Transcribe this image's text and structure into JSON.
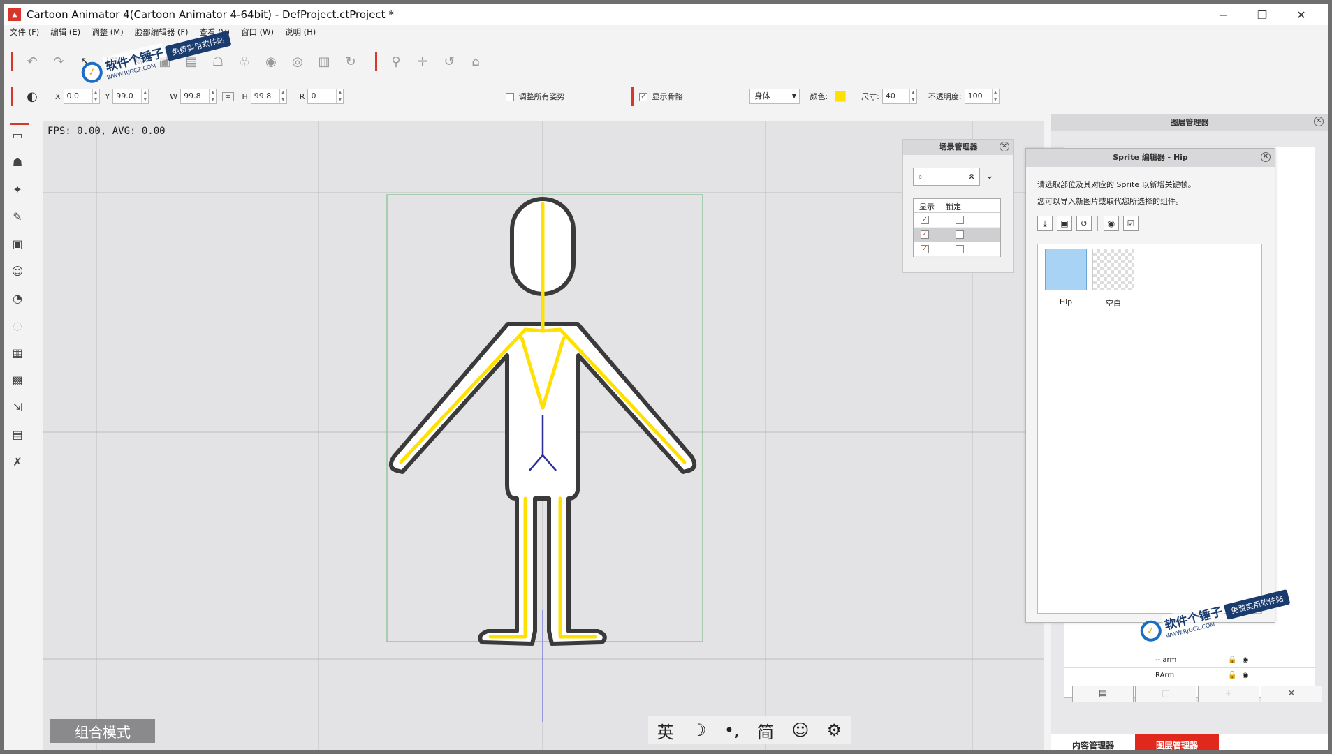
{
  "window": {
    "title": "Cartoon Animator 4(Cartoon Animator 4-64bit) - DefProject.ctProject *",
    "minimize": "−",
    "restore": "❐",
    "close": "✕"
  },
  "menu": [
    "文件 (F)",
    "编辑 (E)",
    "调整 (M)",
    "脸部编辑器 (F)",
    "查看 (V)",
    "窗口 (W)",
    "说明 (H)"
  ],
  "transform": {
    "x_label": "X",
    "x_value": "0.0",
    "y_label": "Y",
    "y_value": "99.0",
    "w_label": "W",
    "w_value": "99.8",
    "link_label": "∞",
    "h_label": "H",
    "h_value": "99.8",
    "r_label": "R",
    "r_value": "0",
    "adjust_all_poses": "调整所有姿势",
    "show_bones": "显示骨骼",
    "body_select": "身体",
    "color_label": "颜色:",
    "size_label": "尺寸:",
    "size_value": "40",
    "opacity_label": "不透明度:",
    "opacity_value": "100"
  },
  "stage": {
    "fps": "FPS: 0.00, AVG: 0.00",
    "mode_button": "组合模式"
  },
  "ime": [
    "英",
    "☽",
    "•,",
    "简",
    "☺",
    "⚙"
  ],
  "scene_manager": {
    "title": "场景管理器",
    "col_show": "显示",
    "col_lock": "锁定"
  },
  "sprite_editor": {
    "title": "Sprite 编辑器 - Hip",
    "info_line1": "请选取部位及其对应的 Sprite 以新增关键帧。",
    "info_line2": "您可以导入新图片或取代您所选择的组件。",
    "items": [
      {
        "label": "Hip"
      },
      {
        "label": "空白"
      }
    ]
  },
  "layer_manager": {
    "title": "图层管理器",
    "rows": [
      "-- arm",
      "RArm"
    ],
    "tabs": [
      "内容管理器",
      "图层管理器"
    ],
    "delete_label": "✕"
  },
  "watermark": {
    "name": "软件个锤子",
    "url": "WWW.RJGCZ.COM",
    "tag": "免费实用软件站"
  },
  "colors": {
    "accent": "#d9362b",
    "bone": "#ffe000",
    "selection_box": "#7fbf8a",
    "active_tab": "#e0281c"
  }
}
